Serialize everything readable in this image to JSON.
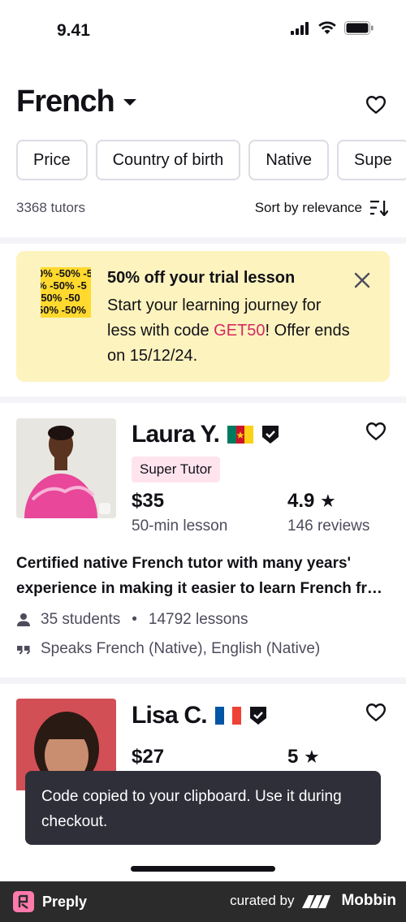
{
  "status_bar": {
    "time": "9.41"
  },
  "header": {
    "title": "French"
  },
  "filters": [
    "Price",
    "Country of birth",
    "Native",
    "Supe"
  ],
  "results": {
    "count": "3368 tutors",
    "sort_label": "Sort by relevance"
  },
  "promo": {
    "image_lines": [
      "0% -50% -5",
      "% -50% -5",
      "-50% -50",
      "50% -50%"
    ],
    "title": "50% off your trial lesson",
    "body_before": "Start your learning journey for less with code ",
    "code": "GET50",
    "body_after": "! Offer ends on 15/12/24."
  },
  "tutors": [
    {
      "name": "Laura Y.",
      "flag": "cameroon-flag",
      "badge": "Super Tutor",
      "price": "$35",
      "price_sub": "50-min lesson",
      "rating": "4.9",
      "reviews": "146 reviews",
      "description_line1": "Certified native French tutor with many years'",
      "description_line2": "experience in making it easier to learn French fr…",
      "students": "35 students",
      "lessons": "14792 lessons",
      "languages": "Speaks French (Native), English (Native)"
    },
    {
      "name": "Lisa C.",
      "flag": "france-flag",
      "price": "$27",
      "rating": "5"
    }
  ],
  "toast": {
    "message": "Code copied to your clipboard. Use it during checkout."
  },
  "brand": {
    "app_name": "Preply",
    "curated_by": "curated by",
    "mobbin": "Mobbin"
  },
  "colors": {
    "promo_bg": "#fdf3bf",
    "code": "#d42a62",
    "badge_bg": "#ffe4ee",
    "toast_bg": "#2f2f3a"
  }
}
